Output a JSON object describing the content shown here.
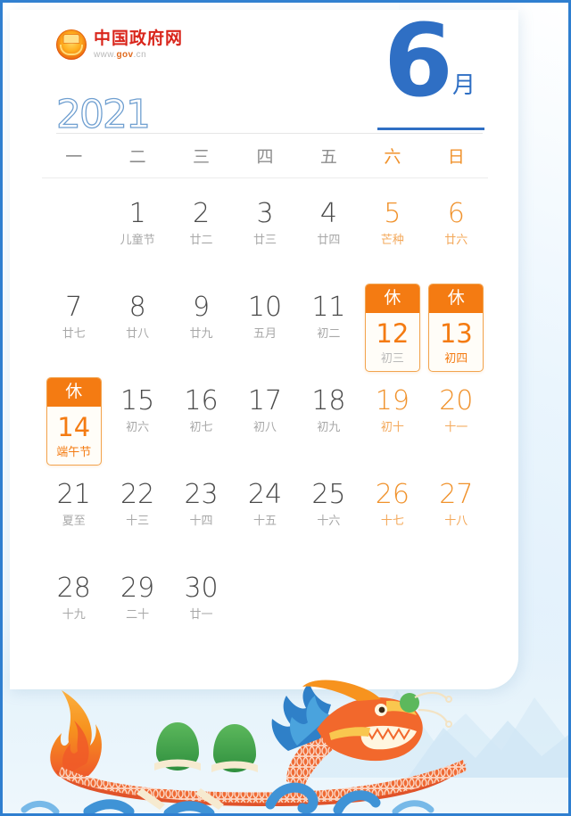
{
  "brand": {
    "logo_icon": "china-national-emblem-icon",
    "name": "中国政府网",
    "url_prefix": "www.",
    "url_mid": "gov",
    "url_suffix": ".cn"
  },
  "header": {
    "year": "2021",
    "month_number": "6",
    "month_suffix": "月"
  },
  "weekdays": [
    {
      "label": "一",
      "weekend": false
    },
    {
      "label": "二",
      "weekend": false
    },
    {
      "label": "三",
      "weekend": false
    },
    {
      "label": "四",
      "weekend": false
    },
    {
      "label": "五",
      "weekend": false
    },
    {
      "label": "六",
      "weekend": true
    },
    {
      "label": "日",
      "weekend": true
    }
  ],
  "rest_label": "休",
  "weeks": [
    [
      {
        "empty": true
      },
      {
        "day": "1",
        "lunar": "儿童节",
        "weekend": false,
        "rest": false
      },
      {
        "day": "2",
        "lunar": "廿二",
        "weekend": false,
        "rest": false
      },
      {
        "day": "3",
        "lunar": "廿三",
        "weekend": false,
        "rest": false
      },
      {
        "day": "4",
        "lunar": "廿四",
        "weekend": false,
        "rest": false
      },
      {
        "day": "5",
        "lunar": "芒种",
        "weekend": true,
        "rest": false
      },
      {
        "day": "6",
        "lunar": "廿六",
        "weekend": true,
        "rest": false
      }
    ],
    [
      {
        "day": "7",
        "lunar": "廿七",
        "weekend": false,
        "rest": false
      },
      {
        "day": "8",
        "lunar": "廿八",
        "weekend": false,
        "rest": false
      },
      {
        "day": "9",
        "lunar": "廿九",
        "weekend": false,
        "rest": false
      },
      {
        "day": "10",
        "lunar": "五月",
        "weekend": false,
        "rest": false
      },
      {
        "day": "11",
        "lunar": "初二",
        "weekend": false,
        "rest": false
      },
      {
        "day": "12",
        "lunar": "初三",
        "weekend": true,
        "rest": true,
        "lunar_highlight": false
      },
      {
        "day": "13",
        "lunar": "初四",
        "weekend": true,
        "rest": true,
        "lunar_highlight": true
      }
    ],
    [
      {
        "day": "14",
        "lunar": "端午节",
        "weekend": false,
        "rest": true,
        "lunar_highlight": true
      },
      {
        "day": "15",
        "lunar": "初六",
        "weekend": false,
        "rest": false
      },
      {
        "day": "16",
        "lunar": "初七",
        "weekend": false,
        "rest": false
      },
      {
        "day": "17",
        "lunar": "初八",
        "weekend": false,
        "rest": false
      },
      {
        "day": "18",
        "lunar": "初九",
        "weekend": false,
        "rest": false
      },
      {
        "day": "19",
        "lunar": "初十",
        "weekend": true,
        "rest": false
      },
      {
        "day": "20",
        "lunar": "十一",
        "weekend": true,
        "rest": false
      }
    ],
    [
      {
        "day": "21",
        "lunar": "夏至",
        "weekend": false,
        "rest": false
      },
      {
        "day": "22",
        "lunar": "十三",
        "weekend": false,
        "rest": false
      },
      {
        "day": "23",
        "lunar": "十四",
        "weekend": false,
        "rest": false
      },
      {
        "day": "24",
        "lunar": "十五",
        "weekend": false,
        "rest": false
      },
      {
        "day": "25",
        "lunar": "十六",
        "weekend": false,
        "rest": false
      },
      {
        "day": "26",
        "lunar": "十七",
        "weekend": true,
        "rest": false
      },
      {
        "day": "27",
        "lunar": "十八",
        "weekend": true,
        "rest": false
      }
    ],
    [
      {
        "day": "28",
        "lunar": "十九",
        "weekend": false,
        "rest": false
      },
      {
        "day": "29",
        "lunar": "二十",
        "weekend": false,
        "rest": false
      },
      {
        "day": "30",
        "lunar": "廿一",
        "weekend": false,
        "rest": false
      },
      {
        "empty": true
      },
      {
        "empty": true
      },
      {
        "empty": true
      },
      {
        "empty": true
      }
    ]
  ],
  "illustration": {
    "name": "dragon-boat-illustration",
    "elements": [
      "dragon-boat",
      "zongzi-figures",
      "flame-tail",
      "blue-waves",
      "mountain-silhouette"
    ]
  },
  "colors": {
    "accent_blue": "#2f6fc4",
    "accent_orange": "#f47b12",
    "weekend_orange": "#f0922c",
    "brand_red": "#d9261c",
    "frame_blue": "#2f7fd0"
  }
}
